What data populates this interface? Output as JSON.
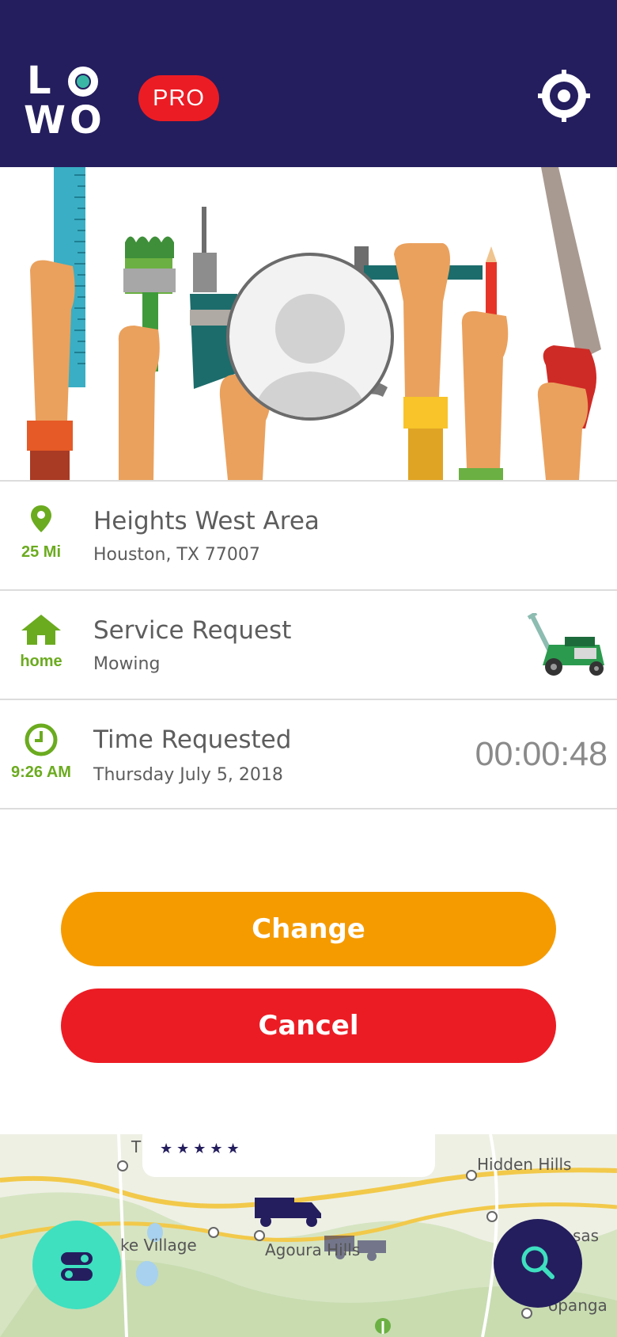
{
  "header": {
    "logo_text": "LOWO",
    "badge": "PRO",
    "location_icon": "crosshair-target-icon"
  },
  "hero": {
    "illustration": "hands-holding-tools-illustration",
    "avatar_icon": "profile-placeholder-icon"
  },
  "rows": [
    {
      "icon": "map-pin-icon",
      "icon_label": "25 Mi",
      "title": "Heights West Area",
      "subtitle": "Houston, TX 77007"
    },
    {
      "icon": "home-icon",
      "icon_label": "home",
      "title": "Service Request",
      "subtitle": "Mowing",
      "trailing_icon": "lawn-mower-icon"
    },
    {
      "icon": "clock-icon",
      "icon_label": "9:26 AM",
      "title": "Time Requested",
      "subtitle": "Thursday July 5, 2018",
      "timer": "00:00:48"
    }
  ],
  "actions": {
    "change_label": "Change",
    "cancel_label": "Cancel"
  },
  "map": {
    "popup_rating": "★★★★★",
    "popup_title": "T",
    "places": [
      "Hidden Hills",
      "ke Village",
      "Agoura Hills",
      "sas",
      "opanga"
    ]
  },
  "colors": {
    "header_bg": "#241e5e",
    "accent_green": "#6bab1f",
    "change_orange": "#f59b00",
    "cancel_red": "#ec1c24",
    "fab_teal": "#3ee0c0"
  }
}
